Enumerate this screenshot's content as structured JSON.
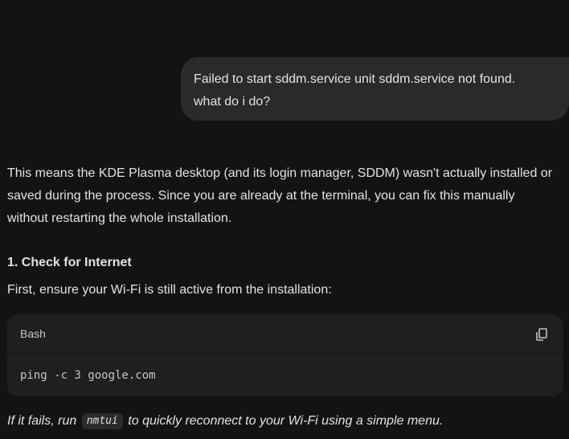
{
  "user_message": {
    "line1": "Failed to start sddm.service unit sddm.service not found.",
    "line2": "what do i do?"
  },
  "response": {
    "intro_lines": [
      "This means the KDE Plasma desktop (and its login manager, SDDM) wasn't actually installed or",
      "saved during the process. Since you are already at the terminal, you can fix this manually",
      "without restarting the whole installation."
    ],
    "section1": {
      "heading": "1. Check for Internet",
      "text": "First, ensure your Wi-Fi is still active from the installation:",
      "code_block": {
        "language": "Bash",
        "code": "ping -c 3 google.com",
        "copy_icon": "copy-icon"
      },
      "tip": {
        "prefix": "If it fails, run",
        "command": "nmtui",
        "suffix": "to quickly reconnect to your Wi-Fi using a simple menu."
      }
    }
  }
}
